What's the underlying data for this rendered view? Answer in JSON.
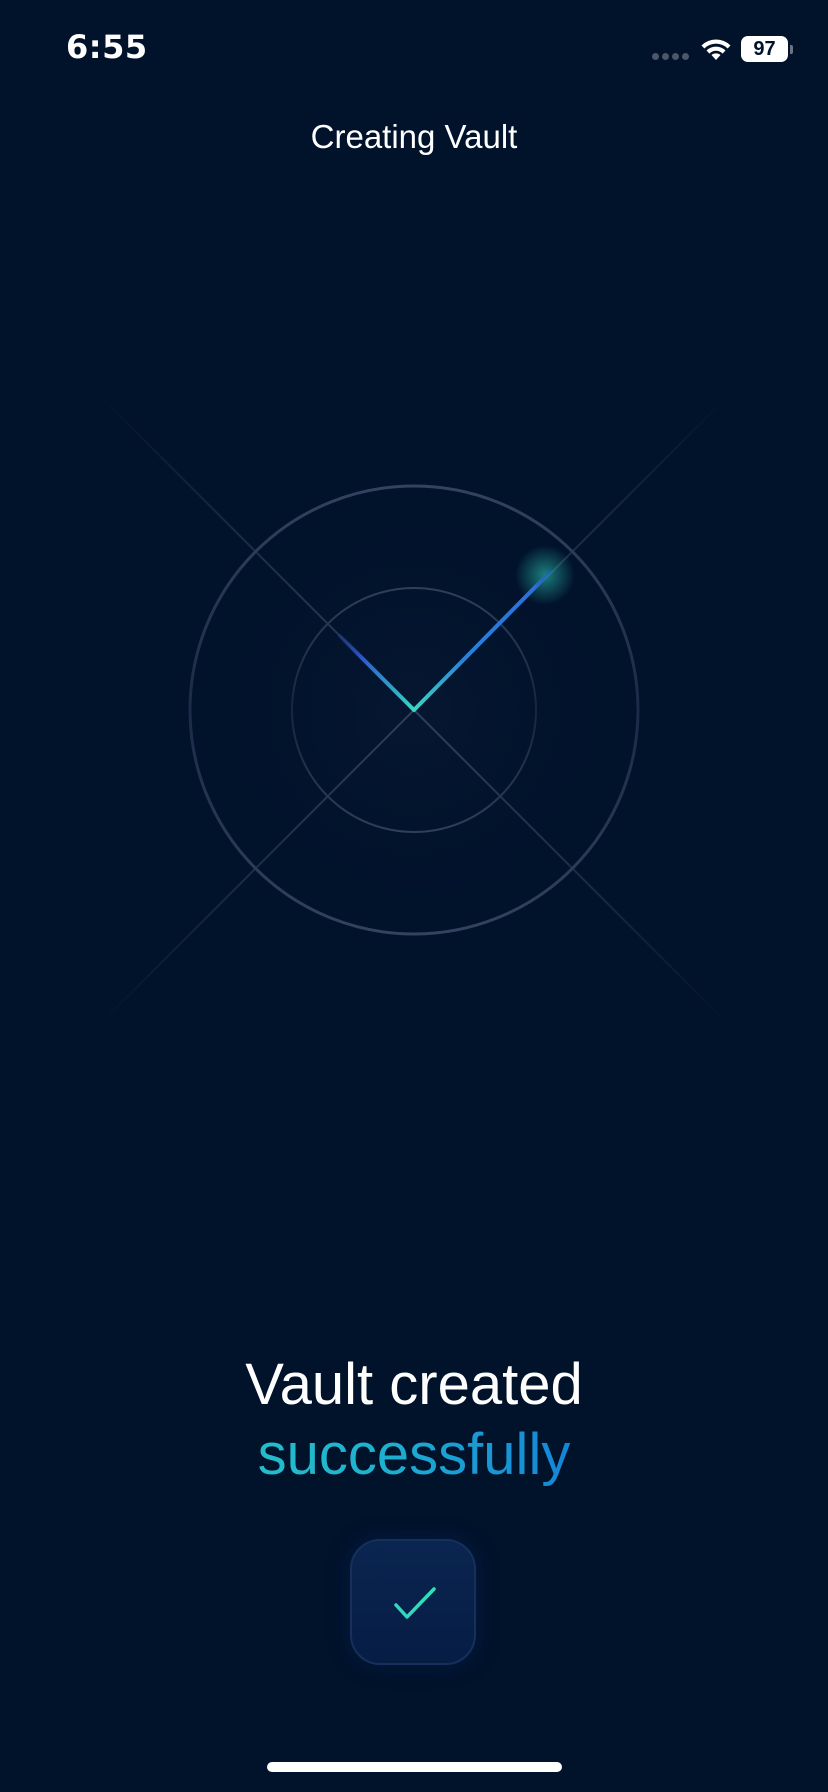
{
  "status_bar": {
    "time": "6:55",
    "battery_level": "97",
    "signal_icon": "cellular-signal-dots",
    "wifi_icon": "wifi-icon"
  },
  "header": {
    "title": "Creating Vault"
  },
  "illustration": {
    "icon": "vault-checkmark-illustration"
  },
  "result": {
    "line1": "Vault created",
    "line2": "successfully"
  },
  "confirm_button": {
    "icon": "checkmark-icon"
  },
  "colors": {
    "background": "#01122b",
    "accent_teal": "#2fd6c0",
    "accent_blue": "#0c49d2",
    "text": "#ffffff"
  }
}
